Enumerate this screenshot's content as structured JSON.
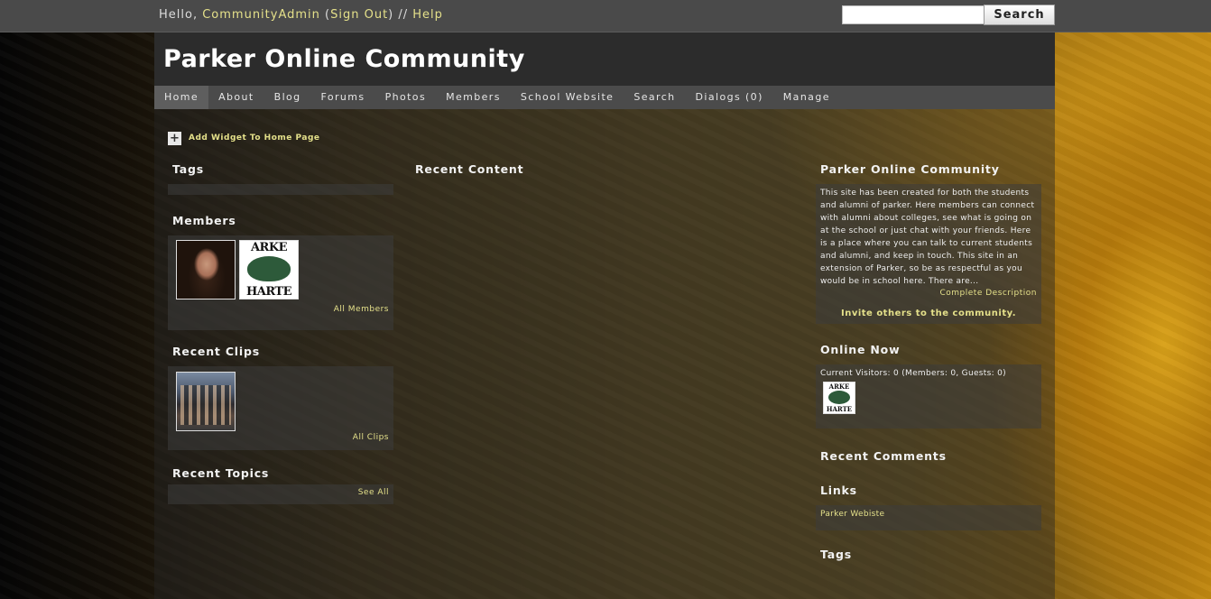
{
  "topbar": {
    "hello": "Hello, ",
    "user": "CommunityAdmin",
    "open_paren": " (",
    "sign_out": "Sign Out",
    "close_paren": ") // ",
    "help": "Help",
    "search_value": "",
    "search_button": "Search"
  },
  "site": {
    "title": "Parker Online Community"
  },
  "nav": [
    {
      "label": "Home",
      "active": true
    },
    {
      "label": "About"
    },
    {
      "label": "Blog"
    },
    {
      "label": "Forums"
    },
    {
      "label": "Photos"
    },
    {
      "label": "Members"
    },
    {
      "label": "School Website"
    },
    {
      "label": "Search"
    },
    {
      "label": "Dialogs (0)"
    },
    {
      "label": "Manage"
    }
  ],
  "add_widget": "Add Widget To Home Page",
  "left": {
    "tags_title": "Tags",
    "members_title": "Members",
    "all_members": "All Members",
    "clips_title": "Recent Clips",
    "all_clips": "All Clips",
    "topics_title": "Recent Topics",
    "see_all": "See All"
  },
  "middle": {
    "recent_content_title": "Recent Content"
  },
  "right": {
    "community_title": "Parker Online Community",
    "description": "This site has been created for both the students and alumni of parker. Here members can connect with alumni about colleges, see what is going on at the school or just chat with your friends. Here is a place where you can talk to current students and alumni, and keep in touch. This site in an extension of Parker, so be as respectful as you would be in school here. There are...",
    "complete_description": "Complete Description",
    "invite": "Invite others to the community.",
    "online_title": "Online Now",
    "online_text": "Current Visitors: 0 (Members: 0, Guests: 0)",
    "comments_title": "Recent Comments",
    "links_title": "Links",
    "link_1": "Parker Webiste",
    "tags_title": "Tags"
  },
  "logo_text": {
    "top": "ARKE",
    "bottom": "HARTE"
  },
  "colors": {
    "link": "#e4e08a",
    "header_bg": "#2c2c2c",
    "nav_bg": "#4b4b4b",
    "topbar_bg": "#4a4a4a"
  },
  "icons": [
    "plus-icon"
  ]
}
